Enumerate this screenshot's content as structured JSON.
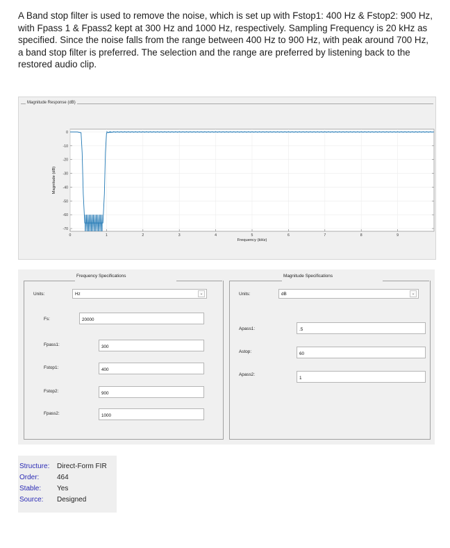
{
  "intro_text": "A Band stop filter is used to remove the noise, which is set up with Fstop1: 400 Hz & Fstop2: 900 Hz, with Fpass 1 & Fpass2 kept at 300 Hz and 1000 Hz, respectively. Sampling Frequency is 20 kHz as specified. Since the noise falls from the range between 400 Hz to 900 Hz, with peak around 700 Hz, a band stop filter is preferred. The selection and the range are preferred by listening back to the restored audio clip.",
  "magnitude_panel": {
    "title": "Magnitude Response (dB)"
  },
  "chart_data": {
    "type": "line",
    "xlabel": "Frequency (kHz)",
    "ylabel": "Magnitude (dB)",
    "xlim": [
      0,
      10
    ],
    "ylim": [
      -72,
      2
    ],
    "x_ticks": [
      0,
      1,
      2,
      3,
      4,
      5,
      6,
      7,
      8,
      9
    ],
    "y_ticks": [
      0,
      -10,
      -20,
      -30,
      -40,
      -50,
      -60,
      -70
    ],
    "series": [
      {
        "color": "#1f77b4",
        "x": [
          0,
          0.2,
          0.3,
          0.33,
          0.36,
          0.4,
          0.9,
          0.94,
          0.97,
          1.0,
          1.2,
          10
        ],
        "y": [
          0,
          0,
          -0.5,
          -15,
          -45,
          -66,
          -66,
          -45,
          -15,
          -0.5,
          0,
          0
        ]
      }
    ],
    "stopband_ripple": {
      "x_range": [
        0.4,
        0.9
      ],
      "y_range": [
        -72,
        -60
      ]
    },
    "grid": true
  },
  "freq_specs": {
    "title": "Frequency Specifications",
    "units_label": "Units:",
    "units_value": "Hz",
    "fs_label": "Fs:",
    "fs_value": "20000",
    "fpass1_label": "Fpass1:",
    "fpass1_value": "300",
    "fstop1_label": "Fstop1:",
    "fstop1_value": "400",
    "fstop2_label": "Fstop2:",
    "fstop2_value": "900",
    "fpass2_label": "Fpass2:",
    "fpass2_value": "1000"
  },
  "mag_specs": {
    "title": "Magnitude Specifications",
    "units_label": "Units:",
    "units_value": "dB",
    "apass1_label": "Apass1:",
    "apass1_value": ".5",
    "astop_label": "Astop:",
    "astop_value": "60",
    "apass2_label": "Apass2:",
    "apass2_value": "1"
  },
  "filter_info": {
    "structure_key": "Structure:",
    "structure_value": "Direct-Form FIR",
    "order_key": "Order:",
    "order_value": "464",
    "stable_key": "Stable:",
    "stable_value": "Yes",
    "source_key": "Source:",
    "source_value": "Designed"
  }
}
